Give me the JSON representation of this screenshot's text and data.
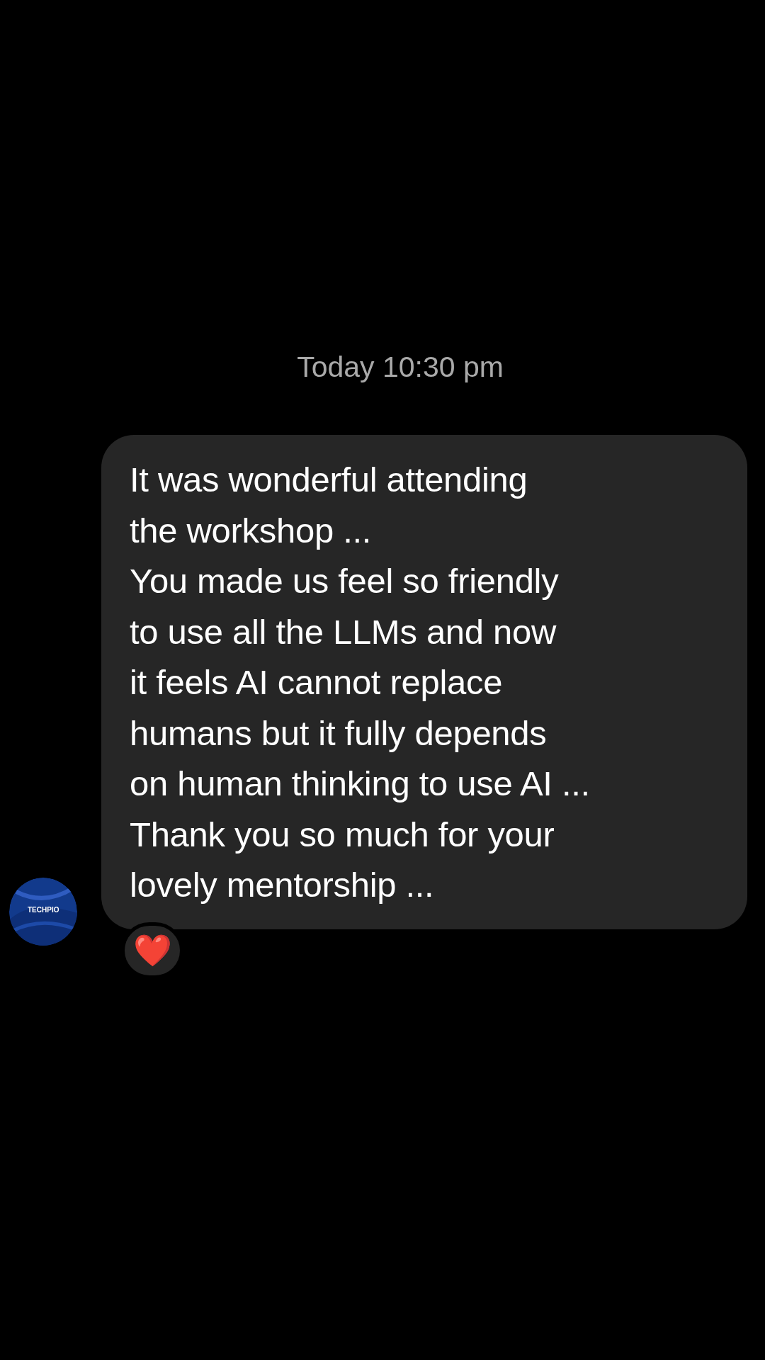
{
  "timestamp": "Today 10:30 pm",
  "message": {
    "sender_avatar": {
      "label": "TECHPIO"
    },
    "text": "It was wonderful attending\nthe workshop ...\nYou made us feel so friendly\nto use all the LLMs and now\nit feels AI cannot replace\nhumans but it fully depends\non human thinking to use AI ...\nThank you so much for your\nlovely mentorship ...",
    "reaction": "❤️"
  }
}
